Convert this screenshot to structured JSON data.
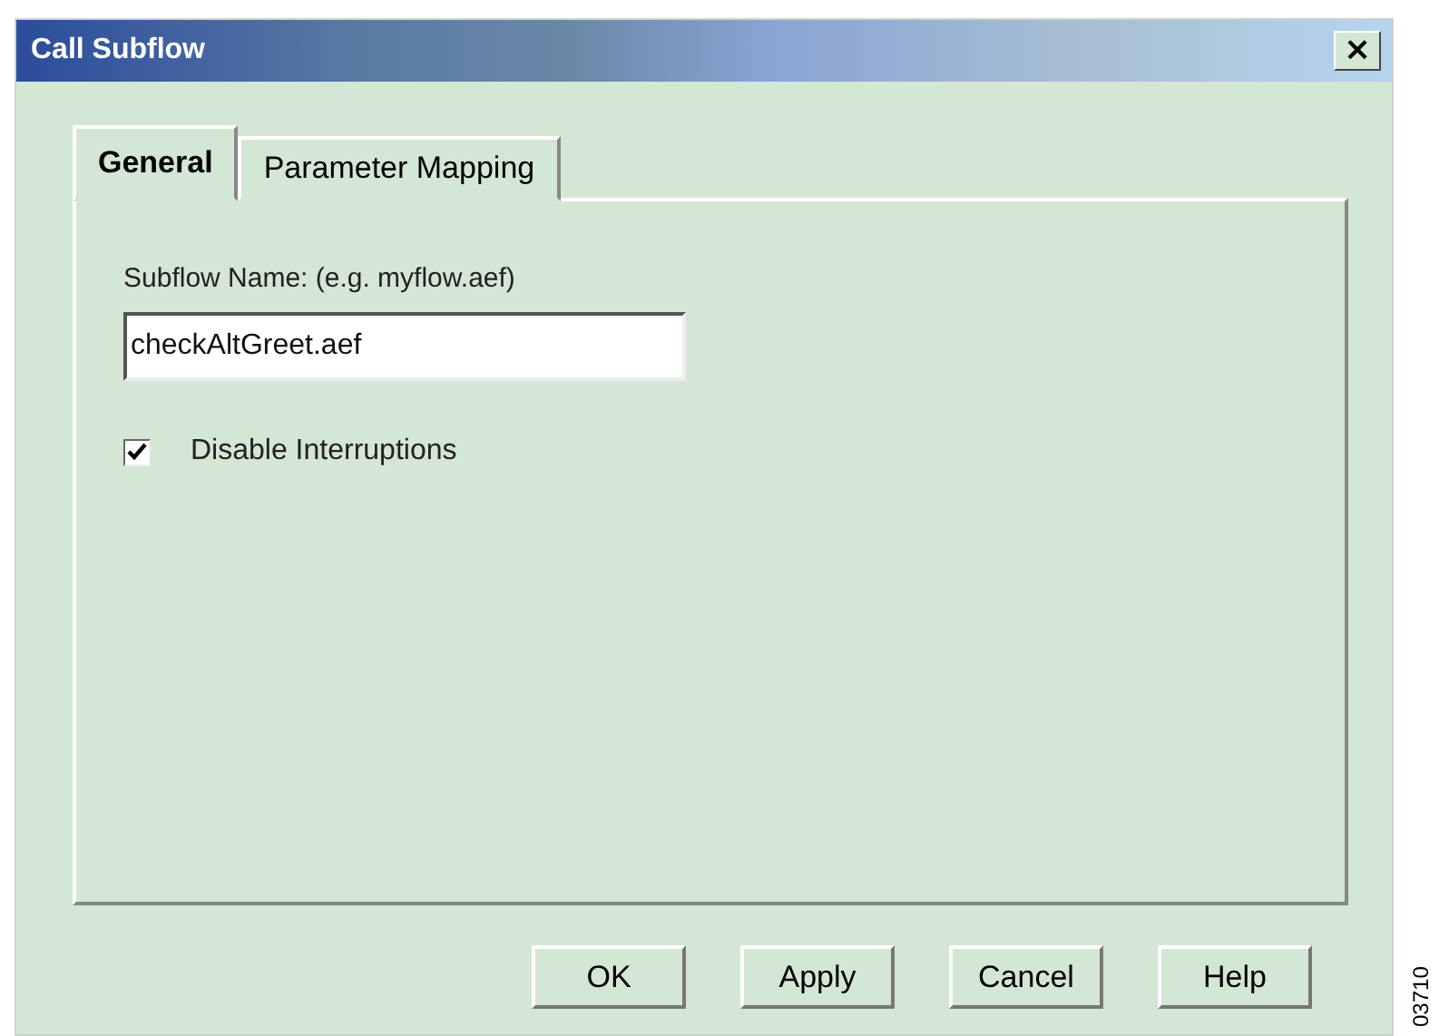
{
  "window": {
    "title": "Call Subflow",
    "close": "×"
  },
  "tabs": [
    {
      "label": "General",
      "selected": true
    },
    {
      "label": "Parameter Mapping",
      "selected": false
    }
  ],
  "subflow_name": {
    "label": "Subflow Name: (e.g. myflow.aef)",
    "value": "checkAltGreet.aef"
  },
  "disable_interruptions": {
    "label": "Disable Interruptions",
    "checked": true
  },
  "buttons": [
    "OK",
    "Apply",
    "Cancel",
    "Help"
  ],
  "figure_id": "03710"
}
